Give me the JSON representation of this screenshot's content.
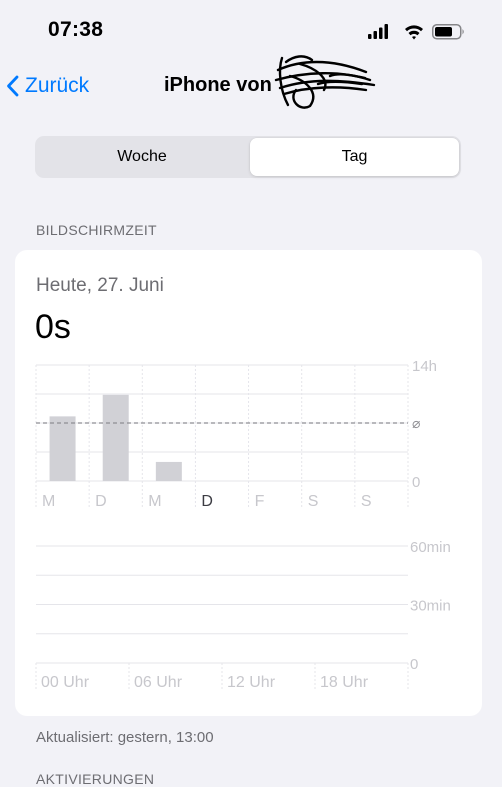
{
  "status_bar": {
    "time": "07:38"
  },
  "nav": {
    "back_label": "Zurück",
    "title": "iPhone von"
  },
  "segmented": {
    "week_label": "Woche",
    "day_label": "Tag",
    "selected": "Tag"
  },
  "section_header": "BILDSCHIRMZEIT",
  "summary": {
    "date": "Heute, 27. Juni",
    "total": "0s"
  },
  "chart_data": [
    {
      "type": "bar",
      "categories": [
        "M",
        "D",
        "M",
        "D",
        "F",
        "S",
        "S"
      ],
      "values": [
        7.8,
        10.4,
        2.3,
        0,
        0,
        0,
        0
      ],
      "ylim": [
        0,
        14
      ],
      "y_tick_labels": [
        "14h",
        "⌀",
        "0"
      ],
      "average_value": 7,
      "average_symbol": "⌀",
      "highlighted_category_index": 3,
      "bar_color": "#d1d1d6",
      "grid": true
    },
    {
      "type": "bar",
      "x_tick_labels": [
        "00 Uhr",
        "06 Uhr",
        "12 Uhr",
        "18 Uhr"
      ],
      "values": [],
      "ylim": [
        0,
        60
      ],
      "y_tick_labels": [
        "60min",
        "30min",
        "0"
      ],
      "grid": true
    }
  ],
  "footer": {
    "updated": "Aktualisiert: gestern, 13:00",
    "next_section": "AKTIVIERUNGEN"
  },
  "colors": {
    "accent": "#007aff",
    "secondary_text": "#6d6d72",
    "background": "#f2f2f7"
  }
}
